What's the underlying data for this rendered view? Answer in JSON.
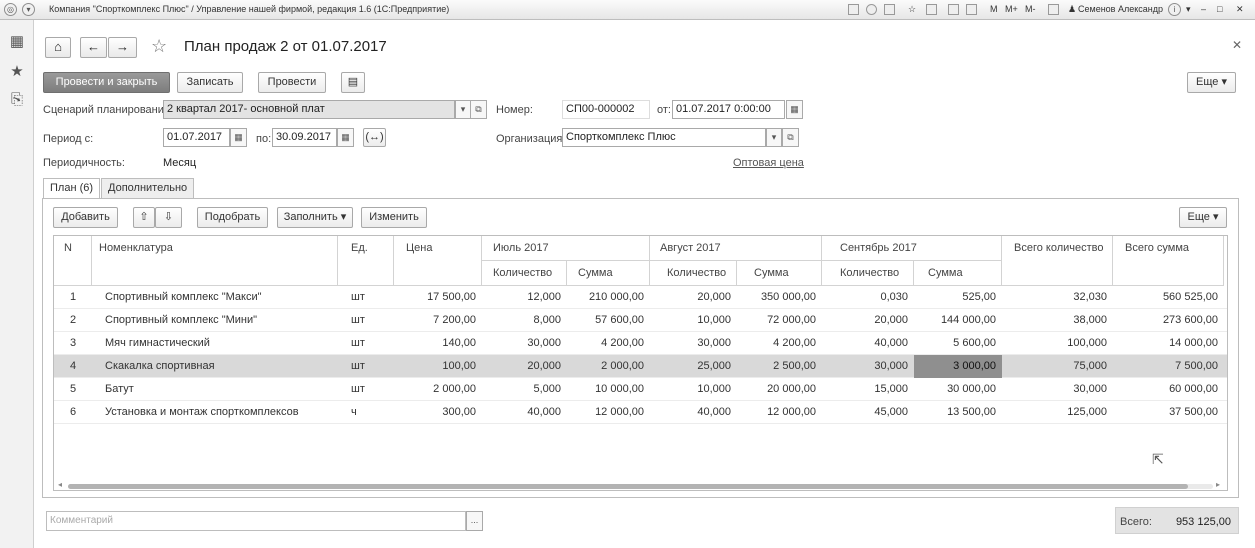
{
  "titlebar": {
    "title": "Компания \"Спорткомплекс Плюс\" / Управление нашей фирмой, редакция 1.6  (1С:Предприятие)",
    "m": "M",
    "mplus": "M+",
    "mminus": "M-",
    "user": "Семенов Александр"
  },
  "header": {
    "title": "План продаж 2 от 01.07.2017",
    "more": "Еще ▾"
  },
  "toolbar": {
    "post_close": "Провести и закрыть",
    "save": "Записать",
    "post": "Провести"
  },
  "form": {
    "scenario_label": "Сценарий планирования:",
    "scenario_value": "2 квартал 2017- основной плат",
    "number_label": "Номер:",
    "number_value": "СП00-000002",
    "date_label": "от:",
    "date_value": "01.07.2017  0:00:00",
    "period_label": "Период с:",
    "period_from": "01.07.2017",
    "period_to_label": "по:",
    "period_to": "30.09.2017",
    "org_label": "Организация:",
    "org_value": "Спорткомплекс Плюс",
    "periodicity_label": "Периодичность:",
    "periodicity_value": "Месяц",
    "price_link": "Оптовая цена"
  },
  "tabs": [
    {
      "label": "План (6)",
      "active": true
    },
    {
      "label": "Дополнительно",
      "active": false
    }
  ],
  "table_toolbar": {
    "add": "Добавить",
    "select": "Подобрать",
    "fill": "Заполнить ▾",
    "change": "Изменить",
    "more": "Еще ▾"
  },
  "table": {
    "headers": {
      "n": "N",
      "item": "Номенклатура",
      "unit": "Ед.",
      "price": "Цена",
      "jul": "Июль 2017",
      "aug": "Август 2017",
      "sep": "Сентябрь 2017",
      "qty": "Количество",
      "sum": "Сумма",
      "total_qty": "Всего количество",
      "total_sum": "Всего сумма"
    },
    "rows": [
      {
        "n": "1",
        "item": "Спортивный комплекс \"Макси\"",
        "unit": "шт",
        "price": "17 500,00",
        "jul_q": "12,000",
        "jul_s": "210 000,00",
        "aug_q": "20,000",
        "aug_s": "350 000,00",
        "sep_q": "0,030",
        "sep_s": "525,00",
        "tot_q": "32,030",
        "tot_s": "560 525,00"
      },
      {
        "n": "2",
        "item": "Спортивный комплекс \"Мини\"",
        "unit": "шт",
        "price": "7 200,00",
        "jul_q": "8,000",
        "jul_s": "57 600,00",
        "aug_q": "10,000",
        "aug_s": "72 000,00",
        "sep_q": "20,000",
        "sep_s": "144 000,00",
        "tot_q": "38,000",
        "tot_s": "273 600,00"
      },
      {
        "n": "3",
        "item": "Мяч гимнастический",
        "unit": "шт",
        "price": "140,00",
        "jul_q": "30,000",
        "jul_s": "4 200,00",
        "aug_q": "30,000",
        "aug_s": "4 200,00",
        "sep_q": "40,000",
        "sep_s": "5 600,00",
        "tot_q": "100,000",
        "tot_s": "14 000,00"
      },
      {
        "n": "4",
        "item": "Скакалка спортивная",
        "unit": "шт",
        "price": "100,00",
        "jul_q": "20,000",
        "jul_s": "2 000,00",
        "aug_q": "25,000",
        "aug_s": "2 500,00",
        "sep_q": "30,000",
        "sep_s": "3 000,00",
        "tot_q": "75,000",
        "tot_s": "7 500,00"
      },
      {
        "n": "5",
        "item": "Батут",
        "unit": "шт",
        "price": "2 000,00",
        "jul_q": "5,000",
        "jul_s": "10 000,00",
        "aug_q": "10,000",
        "aug_s": "20 000,00",
        "sep_q": "15,000",
        "sep_s": "30 000,00",
        "tot_q": "30,000",
        "tot_s": "60 000,00"
      },
      {
        "n": "6",
        "item": "Установка и монтаж спорткомплексов",
        "unit": "ч",
        "price": "300,00",
        "jul_q": "40,000",
        "jul_s": "12 000,00",
        "aug_q": "40,000",
        "aug_s": "12 000,00",
        "sep_q": "45,000",
        "sep_s": "13 500,00",
        "tot_q": "125,000",
        "tot_s": "37 500,00"
      }
    ],
    "selected_row": 4
  },
  "footer": {
    "comment_placeholder": "Комментарий",
    "total_label": "Всего:",
    "total_value": "953 125,00"
  },
  "colors": {
    "selected_row": "#d9d9d9",
    "selected_cell": "#8f8f8f",
    "primary_button": "#8a8a8a"
  }
}
